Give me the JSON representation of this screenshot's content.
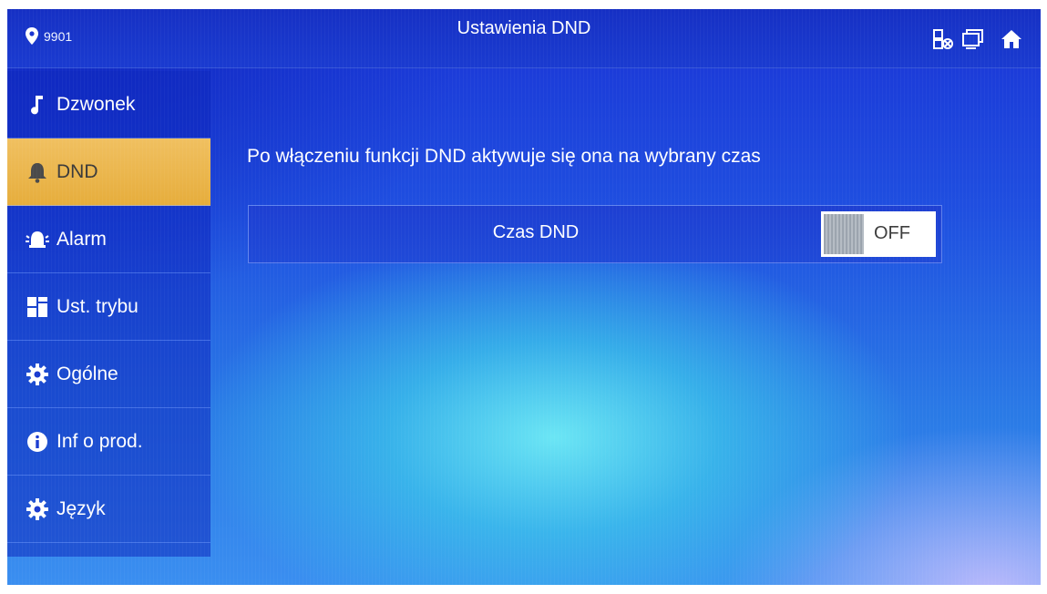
{
  "header": {
    "location": "9901",
    "title": "Ustawienia DND",
    "icons": [
      "location-pin-icon",
      "network-status-icon",
      "monitor-icon",
      "home-icon"
    ]
  },
  "sidebar": {
    "items": [
      {
        "label": "Dzwonek",
        "icon": "music-note-icon",
        "active": false
      },
      {
        "label": "DND",
        "icon": "bell-icon",
        "active": true
      },
      {
        "label": "Alarm",
        "icon": "alarm-siren-icon",
        "active": false
      },
      {
        "label": "Ust. trybu",
        "icon": "grid-icon",
        "active": false
      },
      {
        "label": "Ogólne",
        "icon": "gear-icon",
        "active": false
      },
      {
        "label": "Inf o prod.",
        "icon": "info-icon",
        "active": false
      },
      {
        "label": "Język",
        "icon": "gear-icon",
        "active": false
      }
    ]
  },
  "main": {
    "description": "Po włączeniu funkcji DND aktywuje się ona na wybrany czas",
    "dnd_row": {
      "label": "Czas DND",
      "toggle_state": "OFF"
    }
  },
  "colors": {
    "active_item": "#e6ad3c",
    "background": "#1f4fe0",
    "text": "#ffffff"
  }
}
